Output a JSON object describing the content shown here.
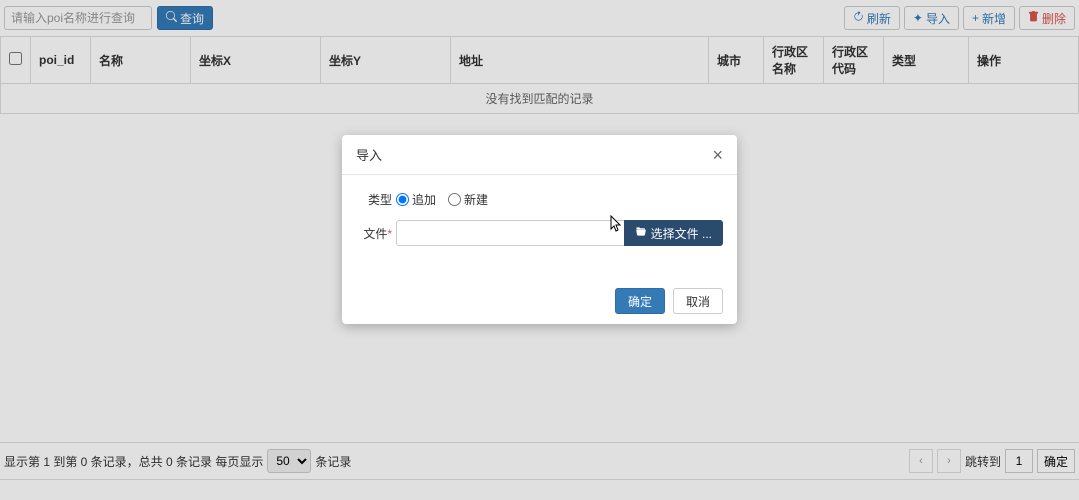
{
  "toolbar": {
    "search_placeholder": "请输入poi名称进行查询",
    "search_btn": "查询",
    "refresh": "刷新",
    "import": "导入",
    "add": "新增",
    "delete": "删除"
  },
  "table": {
    "headers": {
      "poi_id": "poi_id",
      "name": "名称",
      "coord_x": "坐标X",
      "coord_y": "坐标Y",
      "address": "地址",
      "city": "城市",
      "district_name": "行政区名称",
      "district_code": "行政区代码",
      "type": "类型",
      "action": "操作"
    },
    "empty": "没有找到匹配的记录"
  },
  "pager": {
    "info_prefix": "显示第 1 到第 0 条记录，总共 0 条记录 每页显示",
    "info_suffix": "条记录",
    "page_size": "50",
    "jump_label": "跳转到",
    "page_value": "1",
    "go": "确定"
  },
  "modal": {
    "title": "导入",
    "type_label": "类型",
    "type_append": "追加",
    "type_new": "新建",
    "file_label": "文件",
    "file_btn": "选择文件 ...",
    "confirm": "确定",
    "cancel": "取消"
  }
}
